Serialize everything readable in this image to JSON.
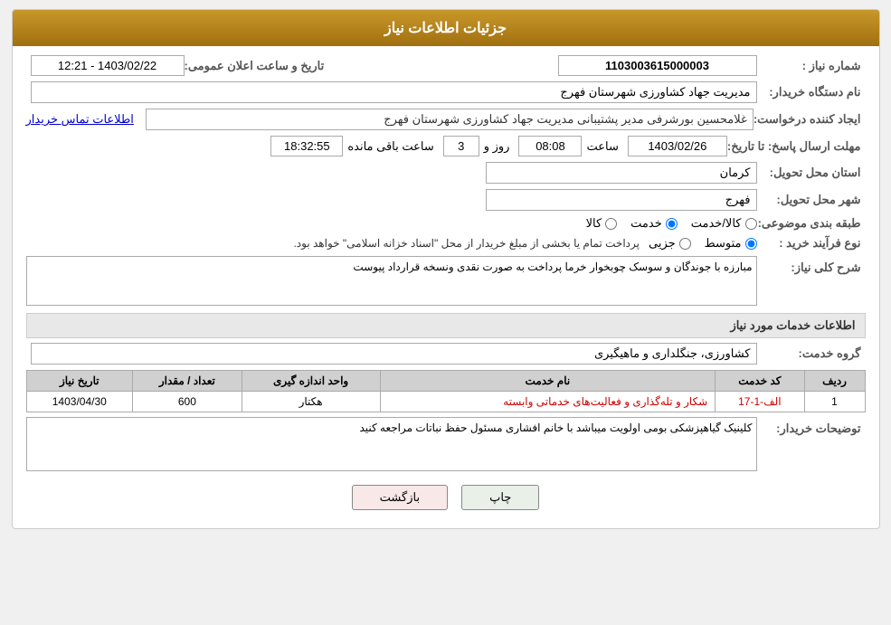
{
  "header": {
    "title": "جزئیات اطلاعات نیاز"
  },
  "fields": {
    "need_number_label": "شماره نیاز :",
    "need_number_value": "1103003615000003",
    "buyer_name_label": "نام دستگاه خریدار:",
    "buyer_name_value": "مدیریت جهاد کشاورزی شهرستان فهرج",
    "creator_label": "ایجاد کننده درخواست:",
    "creator_value": "غلامحسین بورشرفی مدیر پشتیبانی مدیریت جهاد کشاورزی شهرستان فهرج",
    "contact_link": "اطلاعات تماس خریدار",
    "deadline_label": "مهلت ارسال پاسخ: تا تاریخ:",
    "date_value": "1403/02/26",
    "time_label": "ساعت",
    "time_value": "08:08",
    "day_label": "روز و",
    "day_value": "3",
    "remaining_label": "ساعت باقی مانده",
    "remaining_value": "18:32:55",
    "province_label": "استان محل تحویل:",
    "province_value": "کرمان",
    "city_label": "شهر محل تحویل:",
    "city_value": "فهرج",
    "category_label": "طبقه بندی موضوعی:",
    "category_options": [
      "کالا",
      "خدمت",
      "کالا/خدمت"
    ],
    "category_selected": "خدمت",
    "process_label": "نوع فرآیند خرید :",
    "process_options": [
      "جزیی",
      "متوسط"
    ],
    "process_selected": "متوسط",
    "process_note": "پرداخت تمام یا بخشی از مبلغ خریدار از محل \"اسناد خزانه اسلامی\" خواهد بود.",
    "need_desc_label": "شرح کلی نیاز:",
    "need_desc_value": "مبارزه با جوندگان و سوسک چوبخوار خرما پرداخت به صورت نقدی ونسخه قرارداد پیوست",
    "services_section": "اطلاعات خدمات مورد نیاز",
    "service_group_label": "گروه خدمت:",
    "service_group_value": "کشاورزی، جنگلداری و ماهیگیری",
    "table": {
      "headers": [
        "ردیف",
        "کد خدمت",
        "نام خدمت",
        "واحد اندازه گیری",
        "تعداد / مقدار",
        "تاریخ نیاز"
      ],
      "rows": [
        {
          "row": "1",
          "code": "الف-1-17",
          "service_name": "شکار و تله‌گذاری و فعالیت‌های خدماتی وابسته",
          "unit": "هکتار",
          "quantity": "600",
          "date": "1403/04/30"
        }
      ]
    },
    "buyer_notes_label": "توضیحات خریدار:",
    "buyer_notes_value": "کلینیک گیاهپزشکی بومی اولویت میباشد با خانم افشاری مسئول حفظ نباتات مراجعه کنید",
    "btn_print": "چاپ",
    "btn_back": "بازگشت",
    "announce_date_label": "تاریخ و ساعت اعلان عمومی:",
    "announce_date_value": "1403/02/22 - 12:21"
  }
}
